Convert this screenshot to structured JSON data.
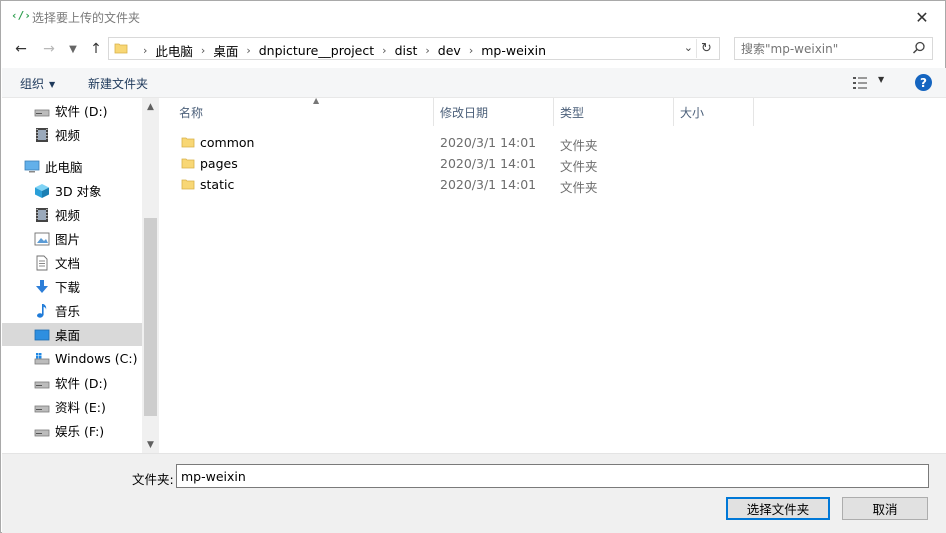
{
  "window": {
    "title": "选择要上传的文件夹",
    "app_icon": "code-brackets-icon"
  },
  "address": {
    "crumbs": [
      "此电脑",
      "桌面",
      "dnpicture__project",
      "dist",
      "dev",
      "mp-weixin"
    ]
  },
  "search": {
    "placeholder": "搜索\"mp-weixin\""
  },
  "toolbar": {
    "organize_label": "组织",
    "new_folder_label": "新建文件夹",
    "help_label": "?"
  },
  "nav": {
    "items": [
      {
        "label": "软件 (D:)",
        "icon": "drive-icon"
      },
      {
        "label": "视频",
        "icon": "video-icon"
      },
      {
        "label": "此电脑",
        "icon": "computer-icon"
      },
      {
        "label": "3D 对象",
        "icon": "cube-icon"
      },
      {
        "label": "视频",
        "icon": "video-icon"
      },
      {
        "label": "图片",
        "icon": "picture-icon"
      },
      {
        "label": "文档",
        "icon": "document-icon"
      },
      {
        "label": "下载",
        "icon": "download-icon"
      },
      {
        "label": "音乐",
        "icon": "music-icon"
      },
      {
        "label": "桌面",
        "icon": "desktop-icon"
      },
      {
        "label": "Windows (C:)",
        "icon": "windows-drive-icon"
      },
      {
        "label": "软件 (D:)",
        "icon": "drive-icon"
      },
      {
        "label": "资料 (E:)",
        "icon": "drive-icon"
      },
      {
        "label": "娱乐 (F:)",
        "icon": "drive-icon"
      }
    ],
    "selected_index": 9
  },
  "columns": {
    "name": "名称",
    "modified": "修改日期",
    "type": "类型",
    "size": "大小"
  },
  "files": [
    {
      "name": "common",
      "modified": "2020/3/1 14:01",
      "type": "文件夹"
    },
    {
      "name": "pages",
      "modified": "2020/3/1 14:01",
      "type": "文件夹"
    },
    {
      "name": "static",
      "modified": "2020/3/1 14:01",
      "type": "文件夹"
    }
  ],
  "bottom": {
    "folder_label": "文件夹:",
    "folder_value": "mp-weixin",
    "select_button": "选择文件夹",
    "cancel_button": "取消"
  },
  "colors": {
    "folder_yellow": "#f8d775",
    "selected_bg": "#d9d9d9",
    "help_blue": "#1565c0"
  }
}
